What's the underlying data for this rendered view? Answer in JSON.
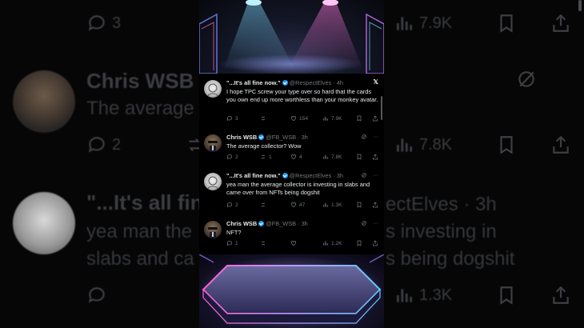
{
  "app": {
    "platform": "X"
  },
  "background": {
    "rows": [
      {
        "comments": "3",
        "views": "7.9K"
      },
      {
        "name": "Chris WSB",
        "text": "The average"
      },
      {
        "comments": "2",
        "views": "7.8K"
      },
      {
        "name": "\"...It's all fine",
        "handle_tail": "ectElves · 3h"
      },
      {
        "line1_left": "yea man the",
        "line1_right": "s investing in"
      },
      {
        "line2_left": "slabs and ca",
        "line2_right": "s being dogshit"
      },
      {
        "views": "1.3K"
      }
    ]
  },
  "tweets": [
    {
      "name": "\"...It's all fine now.\"",
      "handle": "@RespectElves",
      "time": "4h",
      "close_label": "𝕏",
      "text": "I hope TPC screw your type over so hard that the cards you own end up more worthless than your monkey avatar.",
      "replies": "3",
      "reposts": "",
      "likes": "154",
      "views": "7.9K"
    },
    {
      "name": "Chris WSB",
      "handle": "@FB_WSB",
      "time": "3h",
      "text": "The average collector? Wow",
      "replies": "2",
      "reposts": "1",
      "likes": "4",
      "views": "7.8K"
    },
    {
      "name": "\"...It's all fine now.\"",
      "handle": "@RespectElves",
      "time": "3h",
      "text": "yea man the average collector is investing in slabs and came over from NFTs being dogshit",
      "replies": "2",
      "reposts": "",
      "likes": "47",
      "views": "1.3K"
    },
    {
      "name": "Chris WSB",
      "handle": "@FB_WSB",
      "time": "3h",
      "text": "NFT?",
      "replies": "1",
      "reposts": "",
      "likes": "",
      "views": "1.2K"
    }
  ],
  "colors": {
    "verified": "#1d9bf0",
    "muted": "#71767b",
    "text": "#e7e9ea"
  }
}
